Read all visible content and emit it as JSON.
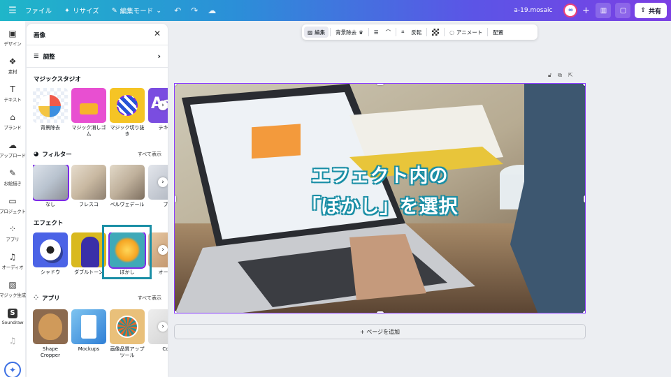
{
  "topbar": {
    "file": "ファイル",
    "resize": "リサイズ",
    "edit_mode": "編集モード",
    "doc_name": "a-19.mosaic",
    "share": "共有"
  },
  "rail": [
    {
      "icon": "design-icon",
      "glyph": "▣",
      "label": "デザイン"
    },
    {
      "icon": "elements-icon",
      "glyph": "❖",
      "label": "素材"
    },
    {
      "icon": "text-icon",
      "glyph": "T",
      "label": "テキスト"
    },
    {
      "icon": "brand-icon",
      "glyph": "⌂",
      "label": "ブランド"
    },
    {
      "icon": "upload-icon",
      "glyph": "☁",
      "label": "アップロード"
    },
    {
      "icon": "draw-icon",
      "glyph": "✎",
      "label": "お絵描き"
    },
    {
      "icon": "project-icon",
      "glyph": "▭",
      "label": "プロジェクト"
    },
    {
      "icon": "apps-icon",
      "glyph": "⁘",
      "label": "アプリ"
    },
    {
      "icon": "audio-icon",
      "glyph": "♫",
      "label": "オーディオ"
    },
    {
      "icon": "magic-gen-icon",
      "glyph": "▨",
      "label": "マジック生成"
    },
    {
      "icon": "soundraw-icon",
      "glyph": "S",
      "label": "Soundraw"
    }
  ],
  "panel": {
    "title": "画像",
    "adjust": "調整",
    "magic_studio": {
      "title": "マジックスタジオ",
      "items": [
        "背景除去",
        "マジック消しゴム",
        "マジック切り抜き",
        "テキス"
      ]
    },
    "filters": {
      "title": "フィルター",
      "see_all": "すべて表示",
      "items": [
        "なし",
        "フレスコ",
        "ベルヴェデール",
        "ブ"
      ]
    },
    "effects": {
      "title": "エフェクト",
      "items": [
        "シャドウ",
        "ダブルトーン",
        "ぼかし",
        "オート"
      ]
    },
    "apps": {
      "title": "アプリ",
      "see_all": "すべて表示",
      "items": [
        "Shape Cropper",
        "Mockups",
        "画像品質アップツール",
        "Co"
      ]
    }
  },
  "context_toolbar": {
    "edit": "編集",
    "bg_remove": "背景除去",
    "flip": "反転",
    "animate": "アニメート",
    "position": "配置"
  },
  "canvas": {
    "overlay_line1": "エフェクト内の",
    "overlay_line2": "「ぼかし」を選択",
    "add_page": "+ ページを追加"
  },
  "colors": {
    "accent": "#7d2ae8",
    "annotation": "#1b8fa6"
  }
}
